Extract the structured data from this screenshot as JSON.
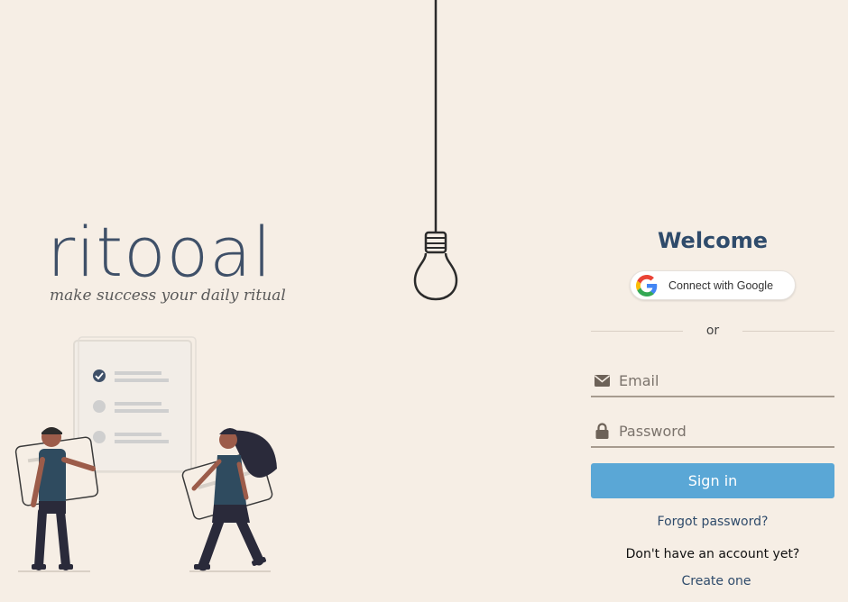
{
  "brand": {
    "name": "ritooal",
    "tagline": "make success your daily ritual"
  },
  "login": {
    "welcome": "Welcome",
    "google_label": "Connect with Google",
    "divider": "or",
    "email_placeholder": "Email",
    "password_placeholder": "Password",
    "signin_label": "Sign in",
    "forgot_label": "Forgot password?",
    "no_account_text": "Don't have an account yet?",
    "create_label": "Create one"
  },
  "colors": {
    "background": "#f6eee5",
    "brand_navy": "#2f4b6b",
    "signin_blue": "#5aa7d6",
    "figure_teal": "#2f4b5f",
    "skin": "#9c5c4a"
  },
  "icons": {
    "email": "envelope-icon",
    "password": "lock-icon",
    "google": "google-g-icon",
    "bulb": "light-bulb-icon"
  }
}
